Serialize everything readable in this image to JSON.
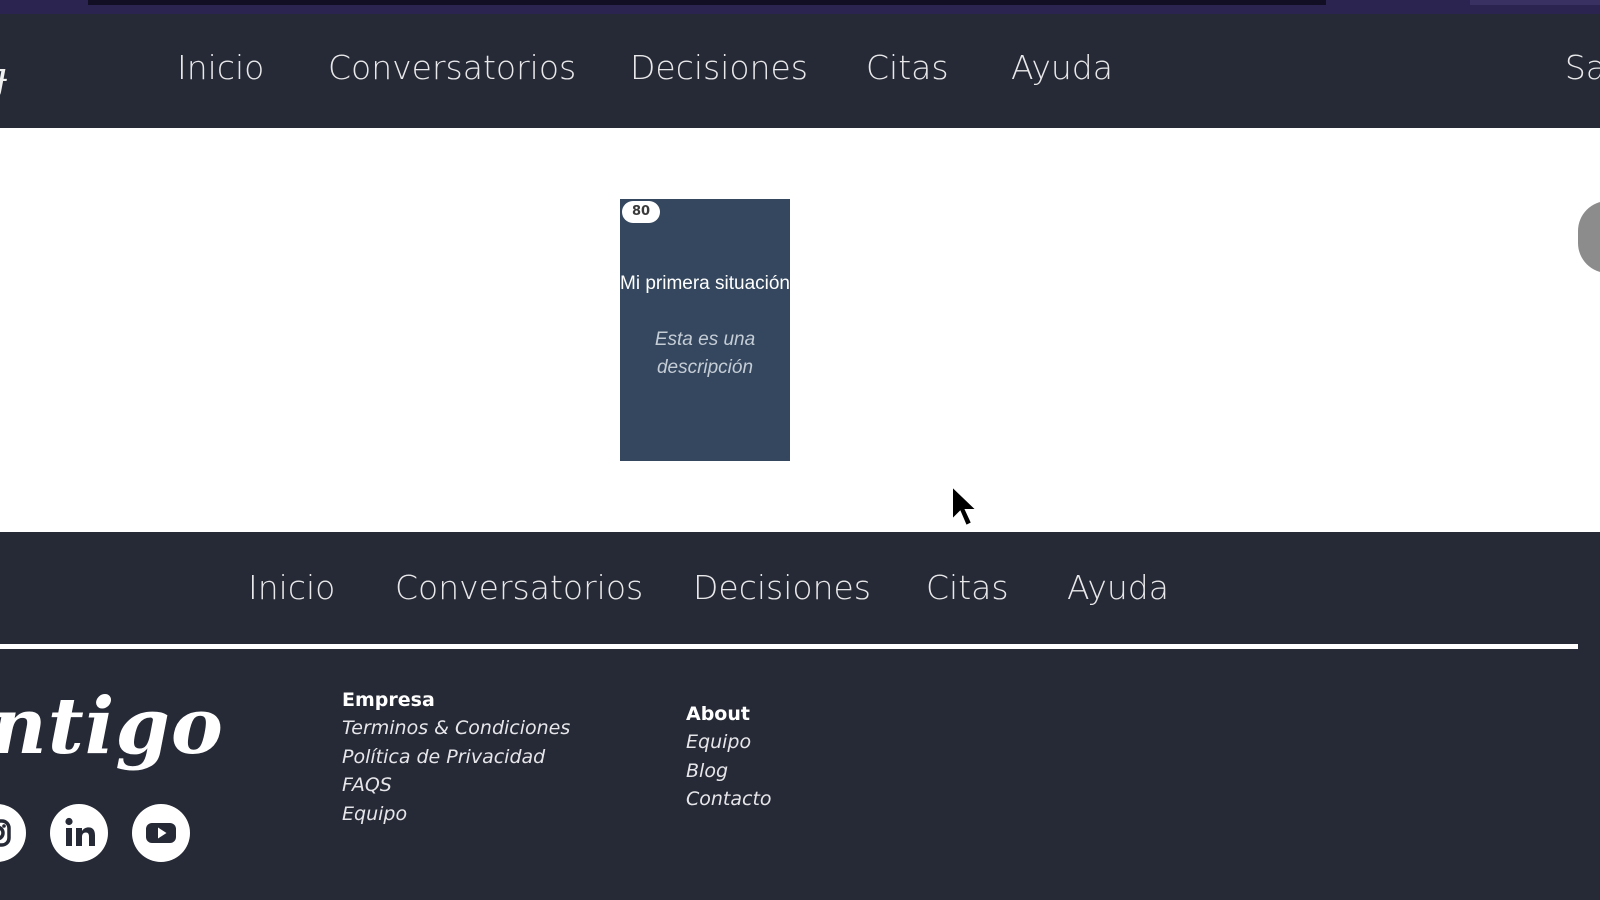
{
  "header": {
    "nav": [
      {
        "label": "Inicio"
      },
      {
        "label": "Conversatorios"
      },
      {
        "label": "Decisiones"
      },
      {
        "label": "Citas"
      },
      {
        "label": "Ayuda"
      }
    ],
    "right_fragment": "Sa"
  },
  "card": {
    "badge": "80",
    "title": "Mi primera situación",
    "description": "Esta es una descripción"
  },
  "footer": {
    "nav": [
      {
        "label": "Inicio"
      },
      {
        "label": "Conversatorios"
      },
      {
        "label": "Decisiones"
      },
      {
        "label": "Citas"
      },
      {
        "label": "Ayuda"
      }
    ],
    "brand": "ntigo",
    "social": [
      {
        "icon": "instagram-icon"
      },
      {
        "icon": "linkedin-icon"
      },
      {
        "icon": "youtube-icon"
      }
    ],
    "columns": [
      {
        "heading": "Empresa",
        "links": [
          "Terminos & Condiciones",
          "Política de Privacidad",
          "FAQS",
          "Equipo"
        ]
      },
      {
        "heading": "About",
        "links": [
          "Equipo",
          "Blog",
          "Contacto"
        ]
      }
    ]
  },
  "colors": {
    "header_bg": "#262a36",
    "card_bg": "#34475e",
    "page_bg": "#ffffff"
  }
}
